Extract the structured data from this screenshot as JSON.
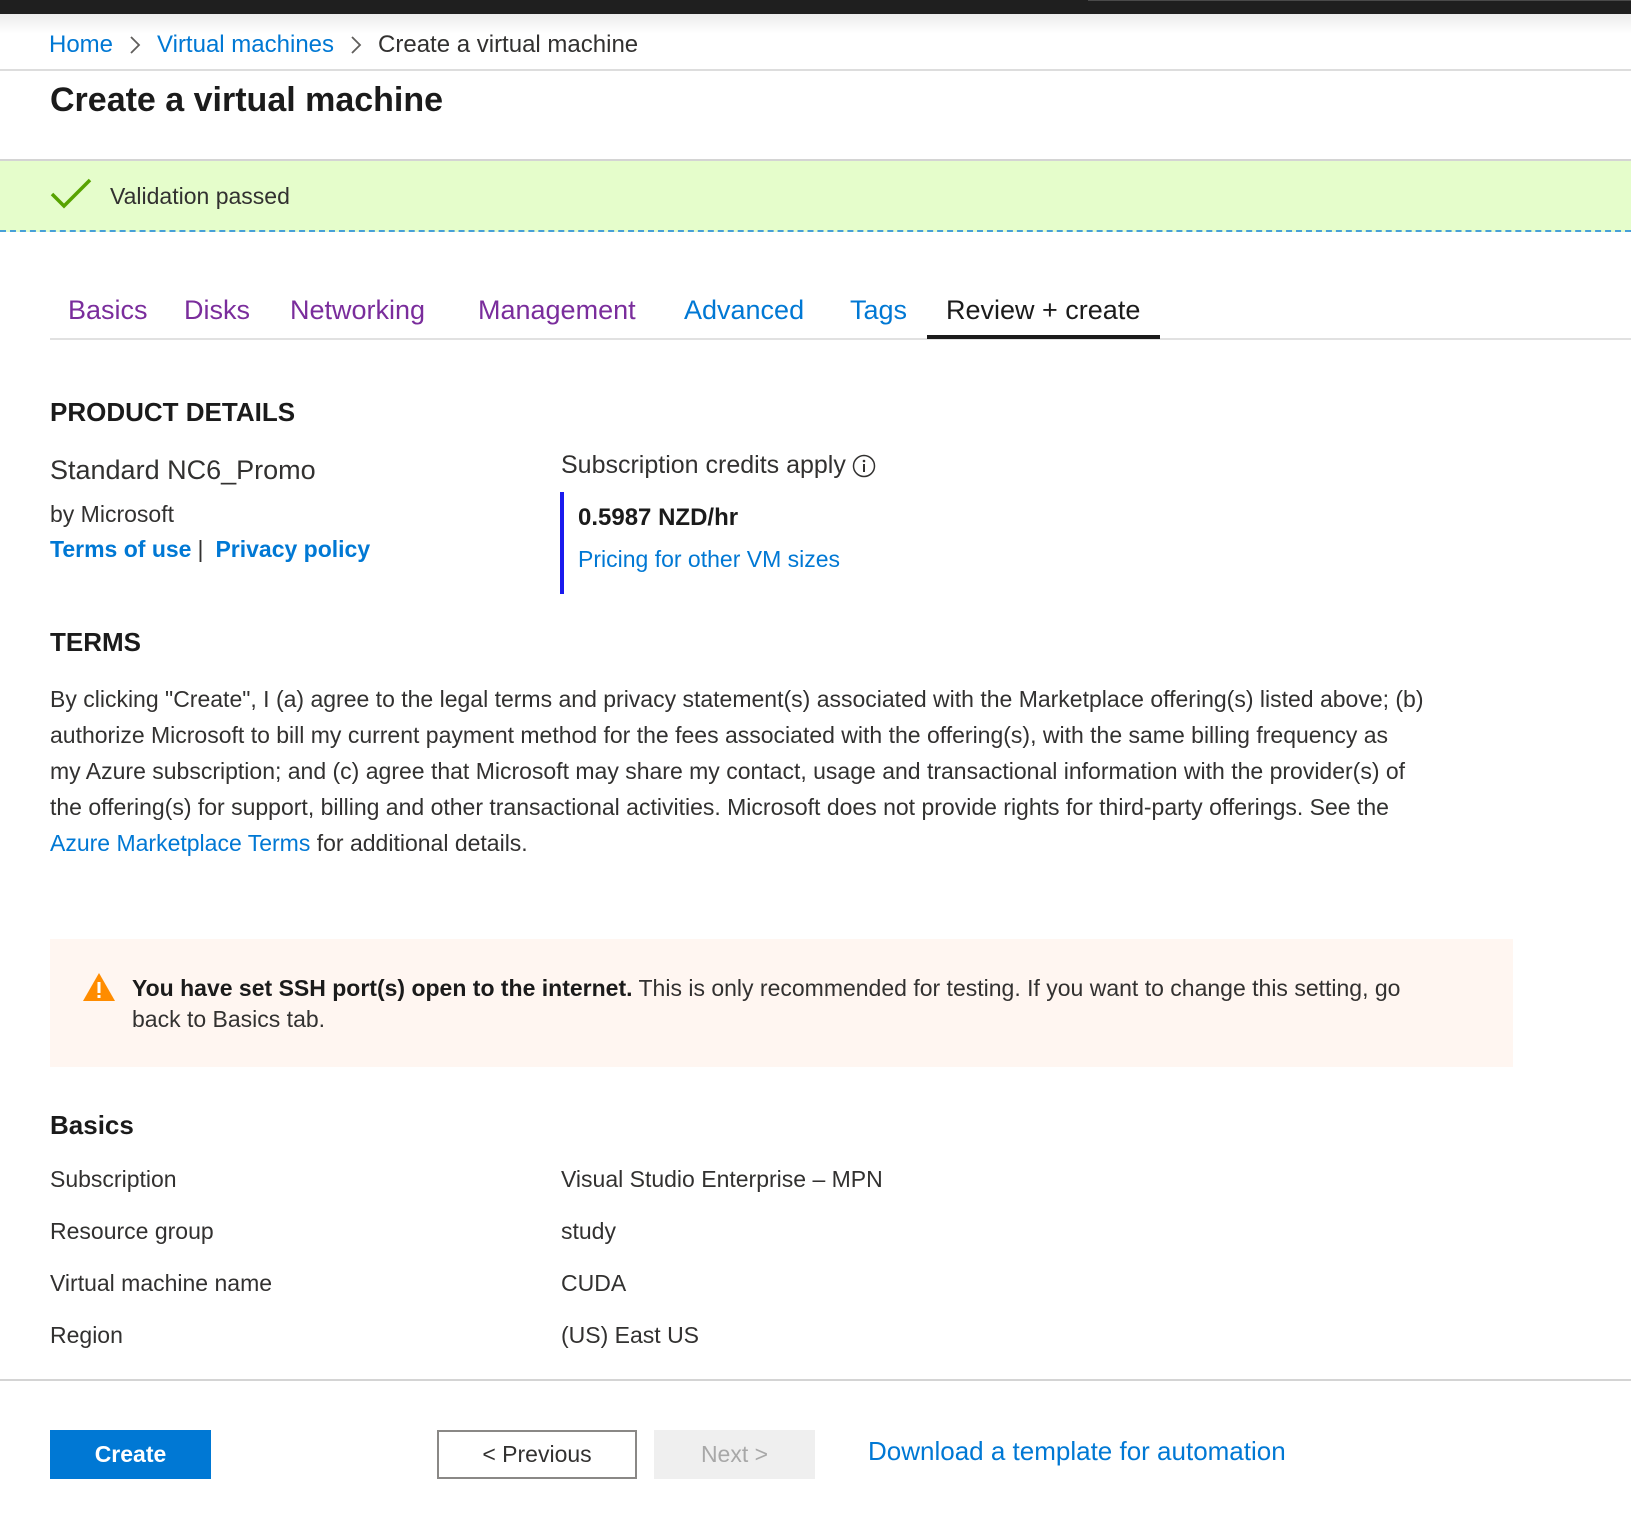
{
  "breadcrumb": {
    "items": [
      {
        "label": "Home"
      },
      {
        "label": "Virtual machines"
      },
      {
        "label": "Create a virtual machine"
      }
    ]
  },
  "page": {
    "title": "Create a virtual machine"
  },
  "validation": {
    "message": "Validation passed",
    "icon": "check-icon",
    "color": "#57a300"
  },
  "tabs": [
    {
      "label": "Basics",
      "state": "visited"
    },
    {
      "label": "Disks",
      "state": "visited"
    },
    {
      "label": "Networking",
      "state": "visited"
    },
    {
      "label": "Management",
      "state": "visited"
    },
    {
      "label": "Advanced",
      "state": "link"
    },
    {
      "label": "Tags",
      "state": "link"
    },
    {
      "label": "Review + create",
      "state": "active"
    }
  ],
  "product": {
    "heading": "PRODUCT DETAILS",
    "name": "Standard NC6_Promo",
    "publisher": "by Microsoft",
    "terms_link": "Terms of use",
    "separator": "|",
    "privacy_link": "Privacy policy",
    "credits_label": "Subscription credits apply",
    "price": "0.5987 NZD/hr",
    "pricing_link": "Pricing for other VM sizes"
  },
  "terms": {
    "heading": "TERMS",
    "lines": [
      "By clicking \"Create\", I (a) agree to the legal terms and privacy statement(s) associated with the Marketplace offering(s) listed above; (b)",
      "authorize Microsoft to bill my current payment method for the fees associated with the offering(s), with the same billing frequency as",
      "my Azure subscription; and (c) agree that Microsoft may share my contact, usage and transactional information with the provider(s) of",
      "the offering(s) for support, billing and other transactional activities. Microsoft does not provide rights for third-party offerings. See the"
    ],
    "link": "Azure Marketplace Terms",
    "suffix": " for additional details."
  },
  "warning": {
    "bold": "You have set SSH port(s) open to the internet.",
    "line1_rest": " This is only recommended for testing.  If you want to change this setting, go",
    "line2": "back to Basics tab.",
    "icon": "warning-icon",
    "icon_color": "#ff8c00"
  },
  "basics": {
    "heading": "Basics",
    "rows": [
      {
        "label": "Subscription",
        "value": "Visual Studio Enterprise – MPN"
      },
      {
        "label": "Resource group",
        "value": "study"
      },
      {
        "label": "Virtual machine name",
        "value": "CUDA"
      },
      {
        "label": "Region",
        "value": "(US) East US"
      }
    ]
  },
  "footer": {
    "create_label": "Create",
    "previous_label": "< Previous",
    "next_label": "Next >",
    "download_link": "Download a template for automation"
  },
  "colors": {
    "accent": "#0078d4",
    "visited_tab": "#7a2d9c",
    "validation_bg": "#e5fdcb",
    "warning_bg": "#fff6f1"
  }
}
